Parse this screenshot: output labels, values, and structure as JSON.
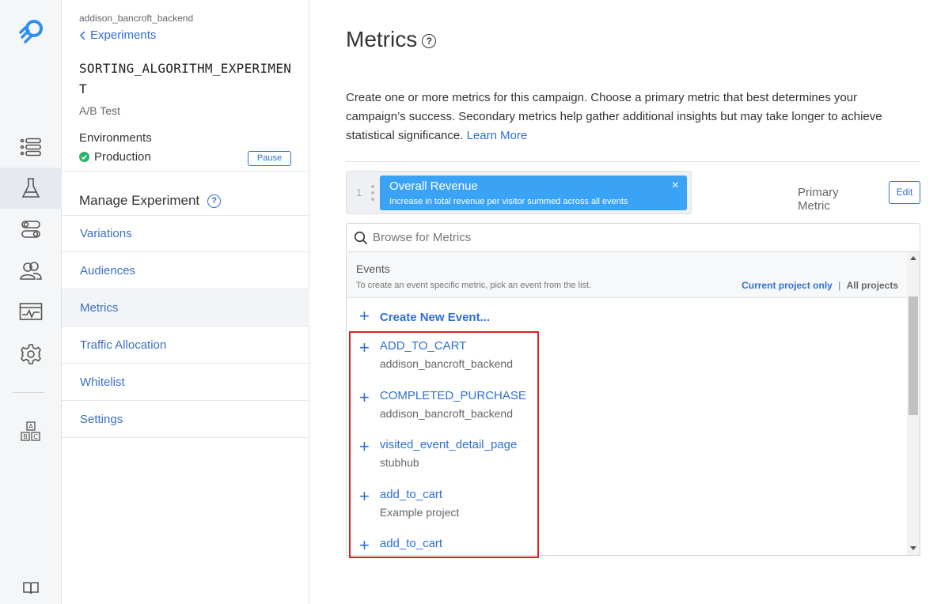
{
  "sidebar": {
    "project": "addison_bancroft_backend",
    "back_label": "Experiments",
    "experiment_title": "SORTING_ALGORITHM_EXPERIMENT",
    "experiment_type": "A/B Test",
    "environments_label": "Environments",
    "environment_name": "Production",
    "pause_label": "Pause",
    "manage_label": "Manage Experiment",
    "help_glyph": "?",
    "nav": [
      {
        "label": "Variations"
      },
      {
        "label": "Audiences"
      },
      {
        "label": "Metrics"
      },
      {
        "label": "Traffic Allocation"
      },
      {
        "label": "Whitelist"
      },
      {
        "label": "Settings"
      }
    ]
  },
  "main": {
    "title": "Metrics",
    "title_help": "?",
    "description": "Create one or more metrics for this campaign. Choose a primary metric that best determines your campaign’s success. Secondary metrics help gather additional insights but may take longer to achieve statistical significance.",
    "learn_more": "Learn More",
    "primary": {
      "index": "1",
      "name": "Overall Revenue",
      "subtitle": "Increase in total revenue per visitor summed across all events",
      "remove_glyph": "×",
      "label": "Primary Metric",
      "edit_label": "Edit"
    },
    "search": {
      "placeholder": "Browse for Metrics"
    },
    "events": {
      "heading": "Events",
      "hint": "To create an event specific metric, pick an event from the list.",
      "scope_current": "Current project only",
      "scope_sep": "|",
      "scope_all": "All projects",
      "create_label": "Create New Event...",
      "plus_glyph": "+",
      "items": [
        {
          "name": "ADD_TO_CART",
          "project": "addison_bancroft_backend"
        },
        {
          "name": "COMPLETED_PURCHASE",
          "project": "addison_bancroft_backend"
        },
        {
          "name": "visited_event_detail_page",
          "project": "stubhub"
        },
        {
          "name": "add_to_cart",
          "project": "Example project"
        },
        {
          "name": "add_to_cart",
          "project": ""
        }
      ]
    }
  },
  "rail_icons": [
    "logo-icon",
    "list-icon",
    "flask-icon",
    "toggles-icon",
    "audiences-icon",
    "monitor-icon",
    "gear-icon",
    "abc-icon",
    "book-icon"
  ],
  "colors": {
    "accent": "#2f6fd6",
    "chip": "#3aa3f5",
    "success": "#2bb36a",
    "highlight": "#e02020"
  }
}
